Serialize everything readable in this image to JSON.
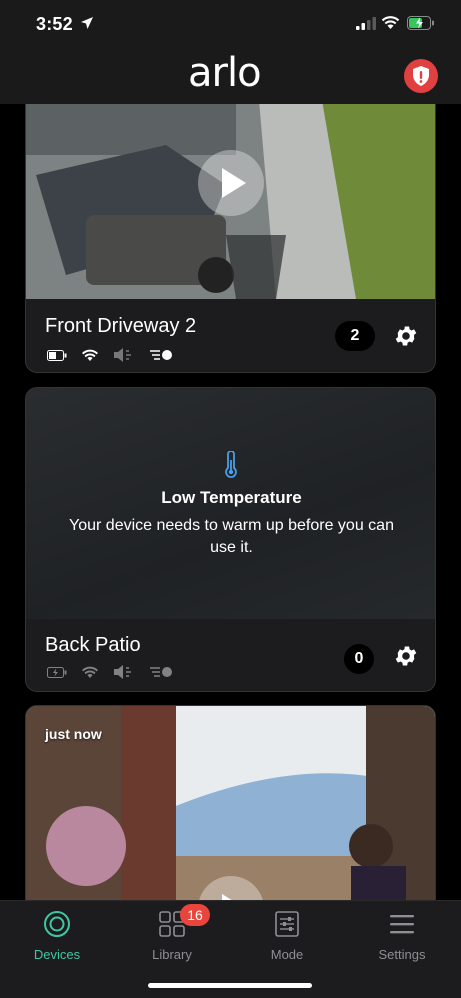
{
  "status_bar": {
    "time": "3:52",
    "icons": [
      "location-arrow-icon",
      "signal-icon",
      "wifi-icon",
      "battery-charging-icon"
    ]
  },
  "header": {
    "logo": "arlo",
    "alert_icon": "shield-alert-icon"
  },
  "cards": [
    {
      "name": "Front Driveway 2",
      "clip_count": "2",
      "status_icons": [
        "battery-icon",
        "wifi-icon",
        "audio-muted-icon",
        "motion-sensitivity-icon"
      ],
      "play_icon": "play-icon",
      "settings_icon": "gear-icon"
    },
    {
      "name": "Back Patio",
      "clip_count": "0",
      "status_icons": [
        "battery-charging-icon",
        "wifi-icon",
        "audio-muted-icon",
        "motion-sensitivity-icon"
      ],
      "notice_icon": "thermometer-icon",
      "notice_title": "Low Temperature",
      "notice_message": "Your device needs to warm up before you can use it.",
      "settings_icon": "gear-icon"
    },
    {
      "timestamp": "just now",
      "play_icon": "play-icon"
    }
  ],
  "tab_bar": {
    "tabs": [
      {
        "label": "Devices",
        "icon": "devices-icon",
        "active": true
      },
      {
        "label": "Library",
        "icon": "library-grid-icon",
        "badge": "16"
      },
      {
        "label": "Mode",
        "icon": "mode-sliders-icon"
      },
      {
        "label": "Settings",
        "icon": "hamburger-menu-icon"
      }
    ]
  },
  "colors": {
    "accent": "#3fc7a0",
    "alert": "#e04040",
    "badge": "#e8453c",
    "background": "#000000",
    "card": "#1c1c1e"
  }
}
